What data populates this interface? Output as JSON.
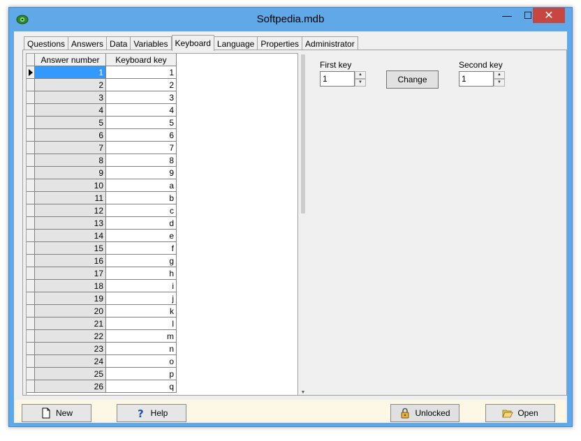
{
  "window": {
    "title": "Softpedia.mdb",
    "minimize_glyph": "—",
    "maximize_glyph": "☐",
    "close_glyph": "✕"
  },
  "tabs": [
    "Questions",
    "Answers",
    "Data",
    "Variables",
    "Keyboard",
    "Language",
    "Properties",
    "Administrator"
  ],
  "active_tab": "Keyboard",
  "grid": {
    "columns": [
      "Answer number",
      "Keyboard key"
    ],
    "rows": [
      {
        "answer": "1",
        "key": "1"
      },
      {
        "answer": "2",
        "key": "2"
      },
      {
        "answer": "3",
        "key": "3"
      },
      {
        "answer": "4",
        "key": "4"
      },
      {
        "answer": "5",
        "key": "5"
      },
      {
        "answer": "6",
        "key": "6"
      },
      {
        "answer": "7",
        "key": "7"
      },
      {
        "answer": "8",
        "key": "8"
      },
      {
        "answer": "9",
        "key": "9"
      },
      {
        "answer": "10",
        "key": "a"
      },
      {
        "answer": "11",
        "key": "b"
      },
      {
        "answer": "12",
        "key": "c"
      },
      {
        "answer": "13",
        "key": "d"
      },
      {
        "answer": "14",
        "key": "e"
      },
      {
        "answer": "15",
        "key": "f"
      },
      {
        "answer": "16",
        "key": "g"
      },
      {
        "answer": "17",
        "key": "h"
      },
      {
        "answer": "18",
        "key": "i"
      },
      {
        "answer": "19",
        "key": "j"
      },
      {
        "answer": "20",
        "key": "k"
      },
      {
        "answer": "21",
        "key": "l"
      },
      {
        "answer": "22",
        "key": "m"
      },
      {
        "answer": "23",
        "key": "n"
      },
      {
        "answer": "24",
        "key": "o"
      },
      {
        "answer": "25",
        "key": "p"
      },
      {
        "answer": "26",
        "key": "q"
      }
    ],
    "selected_row": 0
  },
  "keyboard_settings": {
    "first_key_label": "First key",
    "first_key_value": "1",
    "change_label": "Change",
    "second_key_label": "Second key",
    "second_key_value": "1"
  },
  "bottom_bar": {
    "new_label": "New",
    "help_label": "Help",
    "unlocked_label": "Unlocked",
    "open_label": "Open"
  },
  "colors": {
    "selection": "#3399ff",
    "close_button": "#c7463f",
    "window_frame": "#60a8e8"
  }
}
